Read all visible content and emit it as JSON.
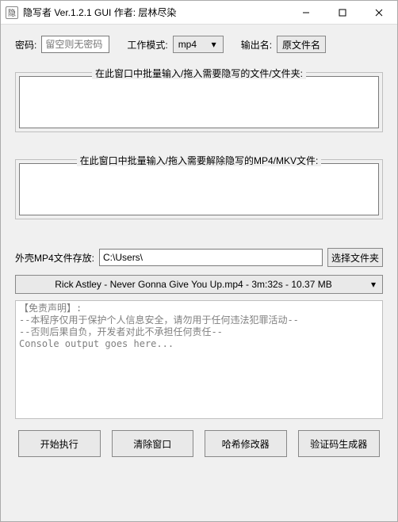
{
  "titlebar": {
    "icon_glyph": "隐",
    "title": "隐写者 Ver.1.2.1 GUI 作者: 层林尽染"
  },
  "row1": {
    "password_label": "密码:",
    "password_placeholder": "留空则无密码",
    "password_value": "",
    "workmode_label": "工作模式:",
    "workmode_value": "mp4",
    "outname_label": "输出名:",
    "outname_value": "原文件名"
  },
  "group_hide": {
    "label": "在此窗口中批量输入/拖入需要隐写的文件/文件夹:"
  },
  "group_reveal": {
    "label": "在此窗口中批量输入/拖入需要解除隐写的MP4/MKV文件:"
  },
  "shell": {
    "path_label": "外壳MP4文件存放:",
    "path_value": "C:\\Users\\",
    "browse_label": "选择文件夹",
    "combo_value": "Rick Astley - Never Gonna Give You Up.mp4 - 3m:32s - 10.37 MB"
  },
  "console_lines": [
    "【免责声明】:",
    "--本程序仅用于保护个人信息安全，请勿用于任何违法犯罪活动--",
    "--否则后果自负，开发者对此不承担任何责任--",
    "Console output goes here..."
  ],
  "buttons": {
    "start": "开始执行",
    "clear": "清除窗口",
    "hash": "哈希修改器",
    "captcha": "验证码生成器"
  }
}
